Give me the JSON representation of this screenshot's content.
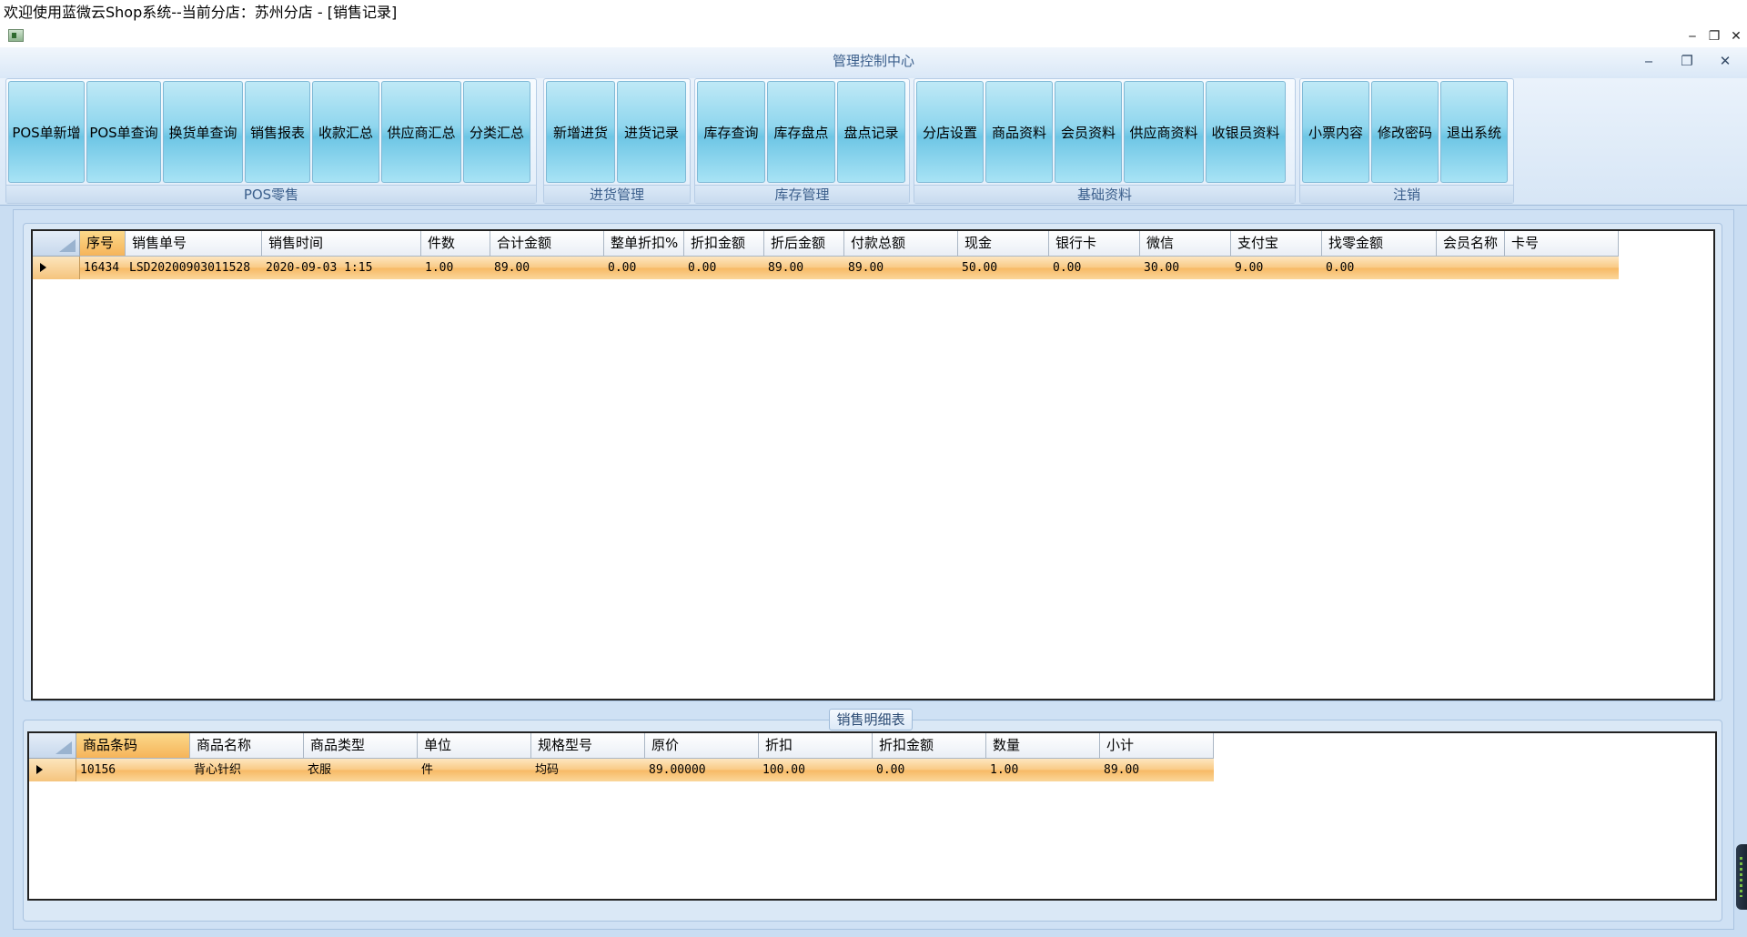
{
  "window": {
    "title": "欢迎使用蓝微云Shop系统--当前分店：苏州分店 - [销售记录]",
    "controls": [
      "‒",
      "❐",
      "✕"
    ]
  },
  "mdi": {
    "title": "管理控制中心",
    "controls": [
      "‒",
      "❐",
      "✕"
    ]
  },
  "ribbon": {
    "groups": [
      {
        "label": "POS零售",
        "buttons": [
          "POS单新增",
          "POS单查询",
          "换货单查询",
          "销售报表",
          "收款汇总",
          "供应商汇总",
          "分类汇总"
        ]
      },
      {
        "label": "进货管理",
        "buttons": [
          "新增进货",
          "进货记录"
        ]
      },
      {
        "label": "库存管理",
        "buttons": [
          "库存查询",
          "库存盘点",
          "盘点记录"
        ]
      },
      {
        "label": "基础资料",
        "buttons": [
          "分店设置",
          "商品资料",
          "会员资料",
          "供应商资料",
          "收银员资料"
        ]
      },
      {
        "label": "注销",
        "buttons": [
          "小票内容",
          "修改密码",
          "退出系统"
        ]
      }
    ]
  },
  "sales_grid": {
    "columns": [
      "序号",
      "销售单号",
      "销售时间",
      "件数",
      "合计金额",
      "整单折扣%",
      "折扣金额",
      "折后金额",
      "付款总额",
      "现金",
      "银行卡",
      "微信",
      "支付宝",
      "找零金额",
      "会员名称",
      "卡号"
    ],
    "rows": [
      [
        "16434",
        "LSD20200903011528",
        "2020-09-03 1:15",
        "1.00",
        "89.00",
        "0.00",
        "0.00",
        "89.00",
        "89.00",
        "50.00",
        "0.00",
        "30.00",
        "9.00",
        "0.00",
        "",
        ""
      ]
    ]
  },
  "detail_panel": {
    "title": "销售明细表",
    "columns": [
      "商品条码",
      "商品名称",
      "商品类型",
      "单位",
      "规格型号",
      "原价",
      "折扣",
      "折扣金额",
      "数量",
      "小计"
    ],
    "rows": [
      [
        "10156",
        "背心针织",
        "衣服",
        "件",
        "均码",
        "89.00000",
        "100.00",
        "0.00",
        "1.00",
        "89.00"
      ]
    ]
  }
}
